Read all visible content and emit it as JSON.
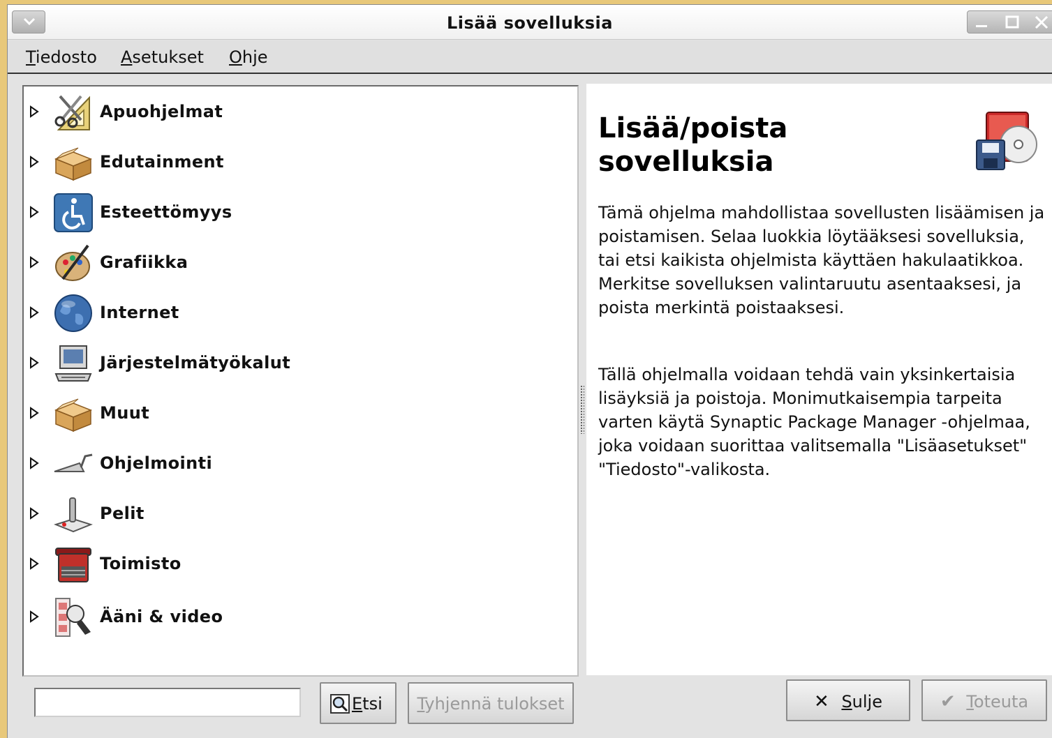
{
  "window": {
    "title": "Lisää sovelluksia"
  },
  "menubar": {
    "items": [
      {
        "mnemonic": "T",
        "rest": "iedosto"
      },
      {
        "mnemonic": "A",
        "rest": "setukset"
      },
      {
        "mnemonic": "O",
        "rest": "hje"
      }
    ]
  },
  "categories": [
    {
      "label": "Apuohjelmat",
      "icon": "accessories-icon"
    },
    {
      "label": "Edutainment",
      "icon": "package-box-icon"
    },
    {
      "label": "Esteettömyys",
      "icon": "accessibility-icon"
    },
    {
      "label": "Grafiikka",
      "icon": "graphics-palette-icon"
    },
    {
      "label": "Internet",
      "icon": "globe-icon"
    },
    {
      "label": "Järjestelmätyökalut",
      "icon": "computer-icon"
    },
    {
      "label": "Muut",
      "icon": "package-box-icon"
    },
    {
      "label": "Ohjelmointi",
      "icon": "trowel-icon"
    },
    {
      "label": "Pelit",
      "icon": "joystick-icon"
    },
    {
      "label": "Toimisto",
      "icon": "typewriter-icon"
    },
    {
      "label": "Ääni & video",
      "icon": "multimedia-icon"
    }
  ],
  "info": {
    "title": "Lisää/poista sovelluksia",
    "paragraph1": "Tämä ohjelma mahdollistaa sovellusten lisäämisen ja poistamisen. Selaa luokkia löytääksesi sovelluksia, tai etsi kaikista ohjelmista käyttäen hakulaatikkoa. Merkitse sovelluksen valintaruutu asentaaksesi, ja poista merkintä poistaaksesi.",
    "paragraph2": "Tällä ohjelmalla voidaan tehdä vain yksinkertaisia lisäyksiä ja poistoja. Monimutkaisempia tarpeita varten käytä Synaptic Package Manager -ohjelmaa, joka voidaan suorittaa valitsemalla \"Lisäasetukset\" \"Tiedosto\"-valikosta."
  },
  "search": {
    "value": ""
  },
  "buttons": {
    "find": {
      "mnemonic": "E",
      "rest": "tsi"
    },
    "clear": {
      "mnemonic": "T",
      "rest": "yhjennä tulokset"
    },
    "close": {
      "mnemonic": "S",
      "rest": "ulje"
    },
    "apply": {
      "mnemonic": "T",
      "rest": "oteuta"
    }
  }
}
